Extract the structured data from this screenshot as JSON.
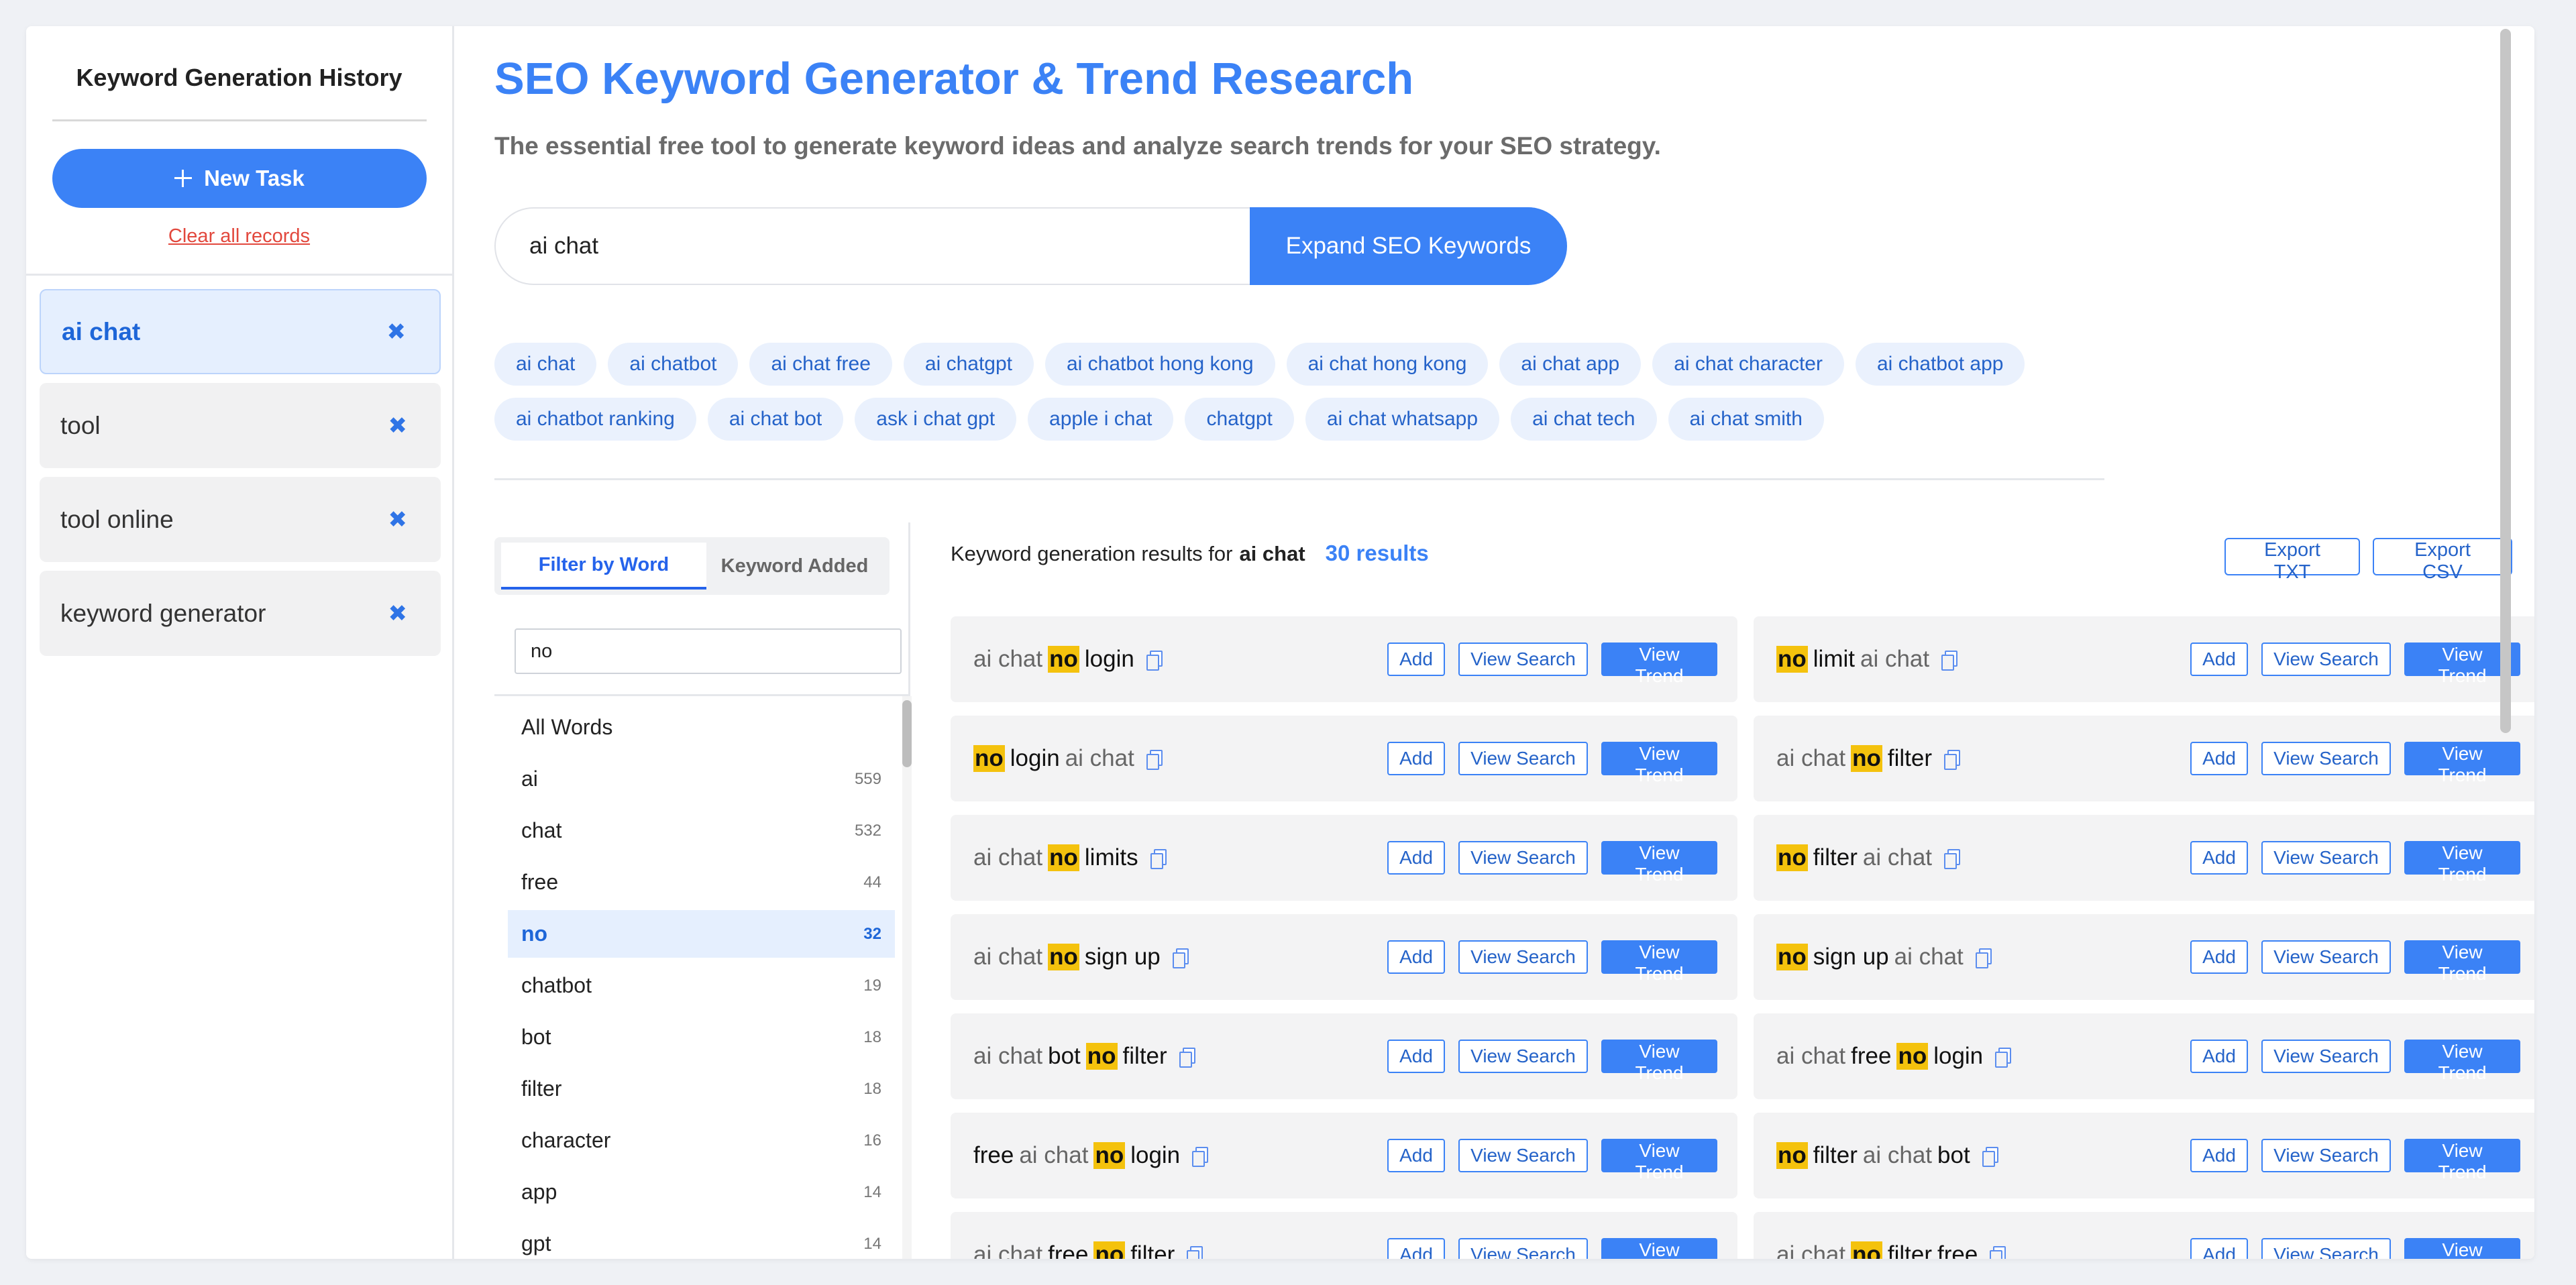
{
  "sidebar": {
    "title": "Keyword Generation History",
    "new_task_label": "New Task",
    "clear_all_label": "Clear all records",
    "items": [
      {
        "label": "ai chat",
        "active": true
      },
      {
        "label": "tool",
        "active": false
      },
      {
        "label": "tool online",
        "active": false
      },
      {
        "label": "keyword generator",
        "active": false
      }
    ]
  },
  "header": {
    "title": "SEO Keyword Generator & Trend Research",
    "subtitle": "The essential free tool to generate keyword ideas and analyze search trends for your SEO strategy."
  },
  "search": {
    "value": "ai chat",
    "button_label": "Expand SEO Keywords"
  },
  "chips": [
    [
      "ai chat",
      "ai chatbot",
      "ai chat free",
      "ai chatgpt",
      "ai chatbot hong kong",
      "ai chat hong kong",
      "ai chat app",
      "ai chat character",
      "ai chatbot app"
    ],
    [
      "ai chatbot ranking",
      "ai chat bot",
      "ask i chat gpt",
      "apple i chat",
      "chatgpt",
      "ai chat whatsapp",
      "ai chat tech",
      "ai chat smith"
    ]
  ],
  "filter": {
    "tab_filter_label": "Filter by Word",
    "tab_added_label": "Keyword Added",
    "input_value": "no",
    "words": [
      {
        "word": "All Words",
        "count": ""
      },
      {
        "word": "ai",
        "count": "559"
      },
      {
        "word": "chat",
        "count": "532"
      },
      {
        "word": "free",
        "count": "44"
      },
      {
        "word": "no",
        "count": "32",
        "active": true
      },
      {
        "word": "chatbot",
        "count": "19"
      },
      {
        "word": "bot",
        "count": "18"
      },
      {
        "word": "filter",
        "count": "18"
      },
      {
        "word": "character",
        "count": "16"
      },
      {
        "word": "app",
        "count": "14"
      },
      {
        "word": "gpt",
        "count": "14"
      }
    ]
  },
  "results": {
    "prefix": "Keyword generation results for",
    "keyword": "ai chat",
    "count_label": "30 results",
    "export_txt_label": "Export TXT",
    "export_csv_label": "Export CSV",
    "add_label": "Add",
    "view_search_label": "View Search",
    "view_trend_label": "View Trend",
    "highlight_color": "#f4c20d",
    "cards": [
      [
        {
          "t": "ai chat",
          "k": "g"
        },
        {
          "t": "no",
          "k": "hl"
        },
        {
          "t": "login",
          "k": "b"
        }
      ],
      [
        {
          "t": "no",
          "k": "hl"
        },
        {
          "t": "limit",
          "k": "b"
        },
        {
          "t": "ai chat",
          "k": "g"
        }
      ],
      [
        {
          "t": "no",
          "k": "hl"
        },
        {
          "t": "login",
          "k": "b"
        },
        {
          "t": "ai chat",
          "k": "g"
        }
      ],
      [
        {
          "t": "ai chat",
          "k": "g"
        },
        {
          "t": "no",
          "k": "hl"
        },
        {
          "t": "filter",
          "k": "b"
        }
      ],
      [
        {
          "t": "ai chat",
          "k": "g"
        },
        {
          "t": "no",
          "k": "hl"
        },
        {
          "t": "limits",
          "k": "b"
        }
      ],
      [
        {
          "t": "no",
          "k": "hl"
        },
        {
          "t": "filter",
          "k": "b"
        },
        {
          "t": "ai chat",
          "k": "g"
        }
      ],
      [
        {
          "t": "ai chat",
          "k": "g"
        },
        {
          "t": "no",
          "k": "hl"
        },
        {
          "t": "sign up",
          "k": "b"
        }
      ],
      [
        {
          "t": "no",
          "k": "hl"
        },
        {
          "t": "sign up",
          "k": "b"
        },
        {
          "t": "ai chat",
          "k": "g"
        }
      ],
      [
        {
          "t": "ai chat",
          "k": "g"
        },
        {
          "t": "bot",
          "k": "b"
        },
        {
          "t": "no",
          "k": "hl"
        },
        {
          "t": "filter",
          "k": "b"
        }
      ],
      [
        {
          "t": "ai chat",
          "k": "g"
        },
        {
          "t": "free",
          "k": "b"
        },
        {
          "t": "no",
          "k": "hl"
        },
        {
          "t": "login",
          "k": "b"
        }
      ],
      [
        {
          "t": "free",
          "k": "b"
        },
        {
          "t": "ai chat",
          "k": "g"
        },
        {
          "t": "no",
          "k": "hl"
        },
        {
          "t": "login",
          "k": "b"
        }
      ],
      [
        {
          "t": "no",
          "k": "hl"
        },
        {
          "t": "filter",
          "k": "b"
        },
        {
          "t": "ai chat",
          "k": "g"
        },
        {
          "t": "bot",
          "k": "b"
        }
      ],
      [
        {
          "t": "ai chat",
          "k": "g"
        },
        {
          "t": "free",
          "k": "b"
        },
        {
          "t": "no",
          "k": "hl"
        },
        {
          "t": "filter",
          "k": "b"
        }
      ],
      [
        {
          "t": "ai chat",
          "k": "g"
        },
        {
          "t": "no",
          "k": "hl"
        },
        {
          "t": "filter",
          "k": "b"
        },
        {
          "t": "free",
          "k": "b"
        }
      ]
    ]
  }
}
